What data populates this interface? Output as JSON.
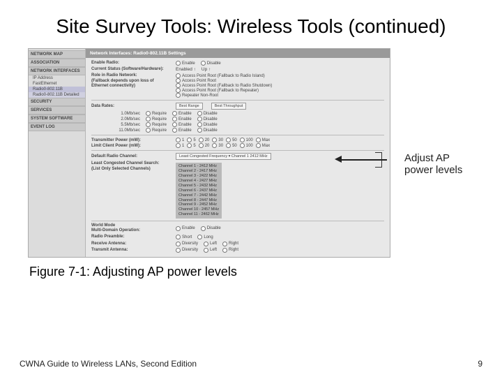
{
  "title": "Site Survey Tools: Wireless Tools (continued)",
  "caption": "Figure 7-1: Adjusting AP power levels",
  "footer_left": "CWNA Guide to Wireless LANs, Second Edition",
  "footer_right": "9",
  "callout": "Adjust AP power levels",
  "sidebar": {
    "sections": [
      {
        "title": "NETWORK MAP"
      },
      {
        "title": "ASSOCIATION"
      },
      {
        "title": "NETWORK INTERFACES",
        "items": [
          "IP Address",
          "FastEthernet",
          "Radio0-802.11B"
        ],
        "selected": 2,
        "sub": "Radio0-802.11B Detailed"
      },
      {
        "title": "SECURITY"
      },
      {
        "title": "SERVICES"
      },
      {
        "title": "SYSTEM SOFTWARE"
      },
      {
        "title": "EVENT LOG"
      }
    ]
  },
  "main": {
    "header": "Network Interfaces: Radio0-802.11B Settings",
    "enable_radio": {
      "label": "Enable Radio:",
      "options": [
        "Enable",
        "Disable"
      ]
    },
    "current_status": {
      "label": "Current Status (Software/Hardware):",
      "value_left": "Enabled ↑",
      "value_right": "Up ↑"
    },
    "role": {
      "label": "Role in Radio Network:\n(Fallback depends upon loss of Ethernet connectivity)",
      "options": [
        "Access Point Root (Fallback to Radio Island)",
        "Access Point Root",
        "Access Point Root (Fallback to Radio Shutdown)",
        "Access Point Root (Fallback to Repeater)",
        "Repeater Non-Root"
      ]
    },
    "data_rates": {
      "label": "Data Rates:",
      "buttons": [
        "Best Range",
        "Best Throughput"
      ],
      "rates": [
        "1.0Mb/sec",
        "2.0Mb/sec",
        "5.5Mb/sec",
        "11.0Mb/sec"
      ],
      "options": [
        "Require",
        "Enable",
        "Disable"
      ]
    },
    "power": {
      "tx": {
        "label": "Transmitter Power (mW):",
        "options": [
          "1",
          "5",
          "20",
          "30",
          "50",
          "100",
          "Max"
        ]
      },
      "client": {
        "label": "Limit Client Power (mW):",
        "options": [
          "1",
          "5",
          "20",
          "30",
          "50",
          "100",
          "Max"
        ]
      }
    },
    "default_channel": {
      "label": "Default Radio Channel:",
      "value": "Least Congested Frequency ▾  Channel 1 2412 MHz"
    },
    "channels": {
      "label": "Least Congested Channel Search:\n(List Only Selected Channels)",
      "list": [
        "Channel 1 - 2412 MHz",
        "Channel 2 - 2417 MHz",
        "Channel 3 - 2422 MHz",
        "Channel 4 - 2427 MHz",
        "Channel 5 - 2432 MHz",
        "Channel 6 - 2437 MHz",
        "Channel 7 - 2442 MHz",
        "Channel 8 - 2447 MHz",
        "Channel 9 - 2452 MHz",
        "Channel 10 - 2457 MHz",
        "Channel 11 - 2462 MHz"
      ]
    },
    "bottom": {
      "world_mode": {
        "label": "World Mode\nMulti-Domain Operation:",
        "options": [
          "Enable",
          "Disable"
        ]
      },
      "preamble": {
        "label": "Radio Preamble:",
        "options": [
          "Short",
          "Long"
        ]
      },
      "rx_antenna": {
        "label": "Receive Antenna:",
        "options": [
          "Diversity",
          "Left",
          "Right"
        ]
      },
      "tx_antenna": {
        "label": "Transmit Antenna:",
        "options": [
          "Diversity",
          "Left",
          "Right"
        ]
      }
    }
  }
}
